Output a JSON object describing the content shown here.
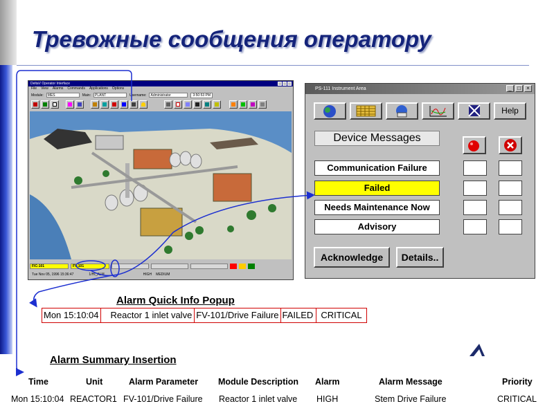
{
  "slide": {
    "title": "Тревожные сообщения оператору"
  },
  "operator_window": {
    "title": "DeltaV Operator Interface",
    "menu": [
      "File",
      "View",
      "Alarms",
      "Commands",
      "Applications",
      "Options"
    ],
    "module_label": "Module:",
    "module_value": "MES",
    "main_label": "Main:",
    "main_value": "PLANT",
    "username_label": "Username:",
    "username_value": "Administrator",
    "clock": "3:50:53 PM",
    "status_tag1": "FIC-101",
    "status_tag2": "FV-101",
    "status_date": "Tue Nov 05, 1996 15:36:47",
    "status_alarm": "1/HI_ALM",
    "status_level": "HIGH",
    "status_priority": "MEDIUM"
  },
  "instrument_window": {
    "title": "PS-111 Instrument Area",
    "help_label": "Help",
    "device_messages_label": "Device Messages",
    "messages": [
      "Communication Failure",
      "Failed",
      "Needs Maintenance Now",
      "Advisory"
    ],
    "acknowledge_label": "Acknowledge",
    "details_label": "Details.."
  },
  "quick_info": {
    "title": "Alarm Quick Info Popup",
    "cells": [
      "Mon 15:10:04",
      "Reactor 1 inlet valve",
      "FV-101/Drive Failure",
      "FAILED",
      "CRITICAL"
    ]
  },
  "alarm_summary": {
    "title": "Alarm Summary Insertion",
    "headers": [
      "Time",
      "Unit",
      "Alarm Parameter",
      "Module Description",
      "Alarm",
      "Alarm Message",
      "Priority"
    ],
    "row": [
      "Mon 15:10:04",
      "REACTOR1",
      "FV-101/Drive Failure",
      "Reactor 1 inlet valve",
      "HIGH",
      "Stem Drive Failure",
      "CRITICAL"
    ]
  },
  "colors": {
    "title": "#14237a",
    "annotation_line": "#1c2fd0",
    "failed_highlight": "#ffff00",
    "popup_border": "#d00000"
  }
}
